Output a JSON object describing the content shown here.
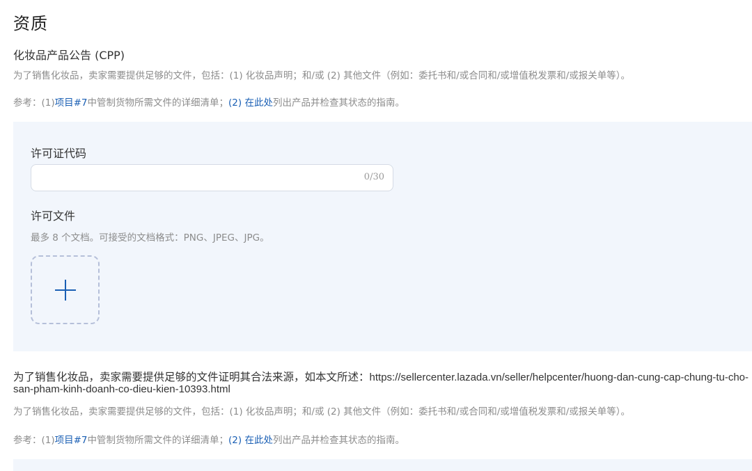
{
  "page": {
    "title": "资质"
  },
  "cpp_section": {
    "heading": "化妆品产品公告 (CPP)",
    "description": "为了销售化妆品，卖家需要提供足够的文件，包括：(1) 化妆品声明；和/或 (2) 其他文件（例如：委托书和/或合同和/或增值税发票和/或报关单等）。",
    "ref_prefix": "参考：(1)",
    "ref_link1": "项目#7",
    "ref_middle": "中管制货物所需文件的详细清单；",
    "ref_link2": "(2) 在此处",
    "ref_suffix": "列出产品并检查其状态的指南。"
  },
  "form": {
    "license_code_label": "许可证代码",
    "license_code_value": "",
    "license_code_count": "0/30",
    "license_file_label": "许可文件",
    "license_file_hint": "最多 8 个文档。可接受的文档格式：PNG、JPEG、JPG。"
  },
  "source_section": {
    "text": "为了销售化妆品，卖家需要提供足够的文件证明其合法来源，如本文所述：",
    "url": "https://sellercenter.lazada.vn/seller/helpcenter/huong-dan-cung-cap-chung-tu-cho- san-pham-kinh-doanh-co-dieu-kien-10393.html",
    "description": "为了销售化妆品，卖家需要提供足够的文件，包括：(1) 化妆品声明；和/或 (2) 其他文件（例如：委托书和/或合同和/或增值税发票和/或报关单等）。",
    "ref_prefix": "参考：(1)",
    "ref_link1": "项目#7",
    "ref_middle": "中管制货物所需文件的详细清单；",
    "ref_link2": "(2) 在此处",
    "ref_suffix": "列出产品并检查其状态的指南。"
  },
  "colors": {
    "link": "#1a5fb4",
    "panel_bg": "#f2f6fc",
    "muted_text": "#8c8c8c"
  }
}
